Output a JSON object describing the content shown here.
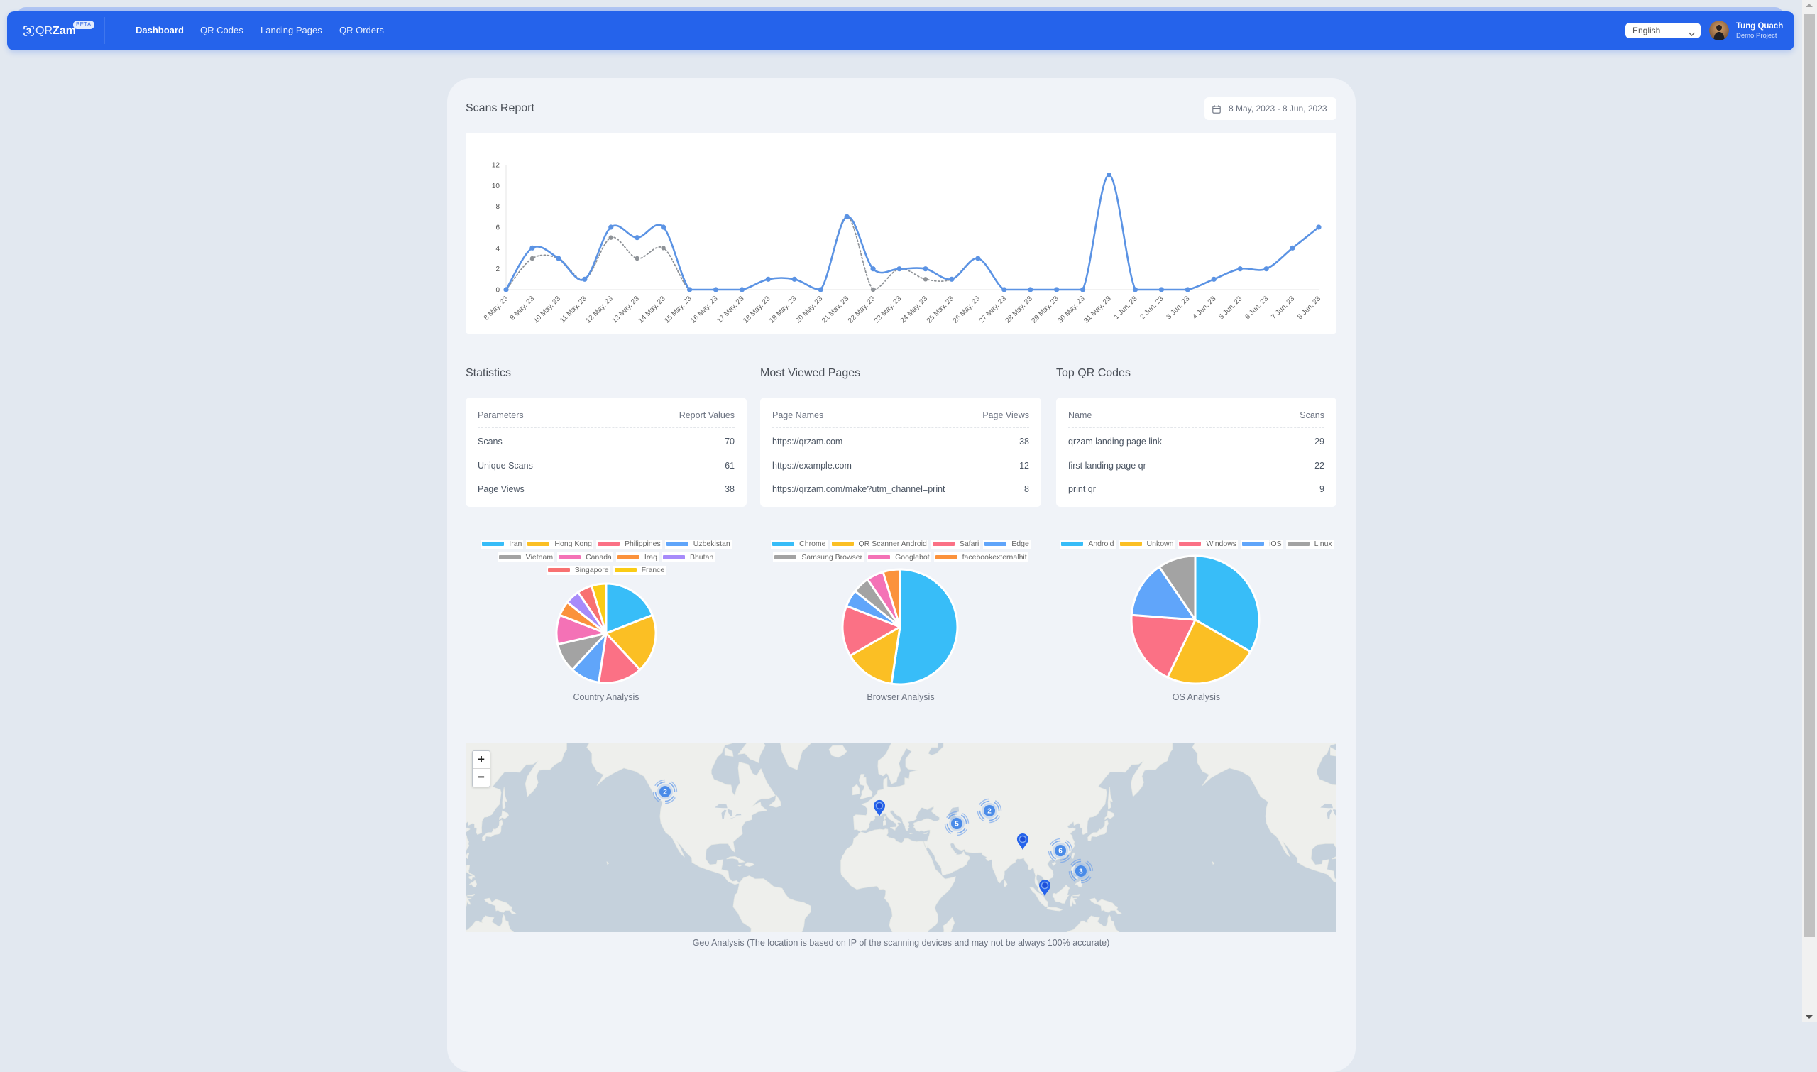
{
  "app": {
    "name_light": "QR",
    "name_bold": "Zam",
    "badge": "BETA"
  },
  "nav": {
    "items": [
      {
        "label": "Dashboard",
        "active": true
      },
      {
        "label": "QR Codes",
        "active": false
      },
      {
        "label": "Landing Pages",
        "active": false
      },
      {
        "label": "QR Orders",
        "active": false
      }
    ]
  },
  "language": {
    "selected": "English"
  },
  "user": {
    "name": "Tung Quach",
    "project": "Demo Project"
  },
  "scans_report": {
    "title": "Scans Report",
    "date_range": "8 May, 2023 - 8 Jun, 2023"
  },
  "statistics": {
    "title": "Statistics",
    "columns": [
      "Parameters",
      "Report Values"
    ],
    "rows": [
      {
        "label": "Scans",
        "value": 70
      },
      {
        "label": "Unique Scans",
        "value": 61
      },
      {
        "label": "Page Views",
        "value": 38
      }
    ]
  },
  "most_viewed_pages": {
    "title": "Most Viewed Pages",
    "columns": [
      "Page Names",
      "Page Views"
    ],
    "rows": [
      {
        "label": "https://qrzam.com",
        "value": 38
      },
      {
        "label": "https://example.com",
        "value": 12
      },
      {
        "label": "https://qrzam.com/make?utm_channel=print",
        "value": 8
      }
    ]
  },
  "top_qr_codes": {
    "title": "Top QR Codes",
    "columns": [
      "Name",
      "Scans"
    ],
    "rows": [
      {
        "label": "qrzam landing page link",
        "value": 29
      },
      {
        "label": "first landing page qr",
        "value": 22
      },
      {
        "label": "print qr",
        "value": 9
      }
    ]
  },
  "geo": {
    "caption": "Geo Analysis (The location is based on IP of the scanning devices and may not be always 100% accurate)",
    "zoom_in_label": "+",
    "zoom_out_label": "−",
    "markers": [
      {
        "type": "cluster",
        "count": 2,
        "lat": 52.8,
        "lon": -121.5
      },
      {
        "type": "pin",
        "count": 1,
        "lat": 43.0,
        "lon": 5.9
      },
      {
        "type": "cluster",
        "count": 5,
        "lat": 39.8,
        "lon": 51.9
      },
      {
        "type": "cluster",
        "count": 2,
        "lat": 45.4,
        "lon": 71.3
      },
      {
        "type": "pin",
        "count": 1,
        "lat": 26.8,
        "lon": 91.1
      },
      {
        "type": "cluster",
        "count": 6,
        "lat": 26.4,
        "lon": 113.5
      },
      {
        "type": "cluster",
        "count": 3,
        "lat": 15.0,
        "lon": 125.7
      },
      {
        "type": "pin",
        "count": 1,
        "lat": 0.4,
        "lon": 104.2
      }
    ]
  },
  "chart_data": [
    {
      "id": "scans-report",
      "type": "line",
      "title": "Scans Report",
      "xlabel": "",
      "ylabel": "",
      "ylim": [
        0,
        12
      ],
      "yticks": [
        0,
        2,
        4,
        6,
        8,
        10,
        12
      ],
      "grid": false,
      "legend": "none",
      "categories": [
        "8 May, 23",
        "9 May, 23",
        "10 May, 23",
        "11 May, 23",
        "12 May, 23",
        "13 May, 23",
        "14 May, 23",
        "15 May, 23",
        "16 May, 23",
        "17 May, 23",
        "18 May, 23",
        "19 May, 23",
        "20 May, 23",
        "21 May, 23",
        "22 May, 23",
        "23 May, 23",
        "24 May, 23",
        "25 May, 23",
        "26 May, 23",
        "27 May, 23",
        "28 May, 23",
        "29 May, 23",
        "30 May, 23",
        "31 May, 23",
        "1 Jun, 23",
        "2 Jun, 23",
        "3 Jun, 23",
        "4 Jun, 23",
        "5 Jun, 23",
        "6 Jun, 23",
        "7 Jun, 23",
        "8 Jun, 23"
      ],
      "series": [
        {
          "name": "Scans",
          "color": "#5b93e4",
          "values": [
            0,
            4,
            3,
            1,
            6,
            5,
            6,
            0,
            0,
            0,
            1,
            1,
            0,
            7,
            2,
            2,
            2,
            1,
            3,
            0,
            0,
            0,
            0,
            11,
            0,
            0,
            0,
            1,
            2,
            2,
            4,
            6
          ]
        },
        {
          "name": "Unique Scans",
          "color": "#8e9297",
          "values": [
            0,
            3,
            3,
            1,
            5,
            3,
            4,
            0,
            0,
            0,
            1,
            1,
            0,
            7,
            0,
            2,
            1,
            1,
            3,
            0,
            0,
            0,
            0,
            11,
            0,
            0,
            0,
            1,
            2,
            2,
            4,
            6
          ]
        }
      ]
    },
    {
      "id": "country-analysis",
      "type": "pie",
      "title": "Country Analysis",
      "legend": "top",
      "labels": [
        "Iran",
        "Hong Kong",
        "Philippines",
        "Uzbekistan",
        "Vietnam",
        "Canada",
        "Iraq",
        "Bhutan",
        "Singapore",
        "France"
      ],
      "values": [
        4,
        4,
        3,
        2,
        2,
        2,
        1,
        1,
        1,
        1
      ],
      "colors": [
        "#38bdf8",
        "#fbbf24",
        "#fb7185",
        "#60a5fa",
        "#a3a3a3",
        "#f472b6",
        "#fb923c",
        "#a78bfa",
        "#f87171",
        "#facc15"
      ]
    },
    {
      "id": "browser-analysis",
      "type": "pie",
      "title": "Browser Analysis",
      "legend": "top",
      "labels": [
        "Chrome",
        "QR Scanner Android",
        "Safari",
        "Edge",
        "Samsung Browser",
        "Googlebot",
        "facebookexternalhit"
      ],
      "values": [
        11,
        3,
        3,
        1,
        1,
        1,
        1
      ],
      "colors": [
        "#38bdf8",
        "#fbbf24",
        "#fb7185",
        "#60a5fa",
        "#a3a3a3",
        "#f472b6",
        "#fb923c"
      ]
    },
    {
      "id": "os-analysis",
      "type": "pie",
      "title": "OS Analysis",
      "legend": "top",
      "labels": [
        "Android",
        "Unkown",
        "Windows",
        "iOS",
        "Linux"
      ],
      "values": [
        7,
        5,
        4,
        3,
        2
      ],
      "colors": [
        "#38bdf8",
        "#fbbf24",
        "#fb7185",
        "#60a5fa",
        "#a3a3a3"
      ]
    }
  ]
}
